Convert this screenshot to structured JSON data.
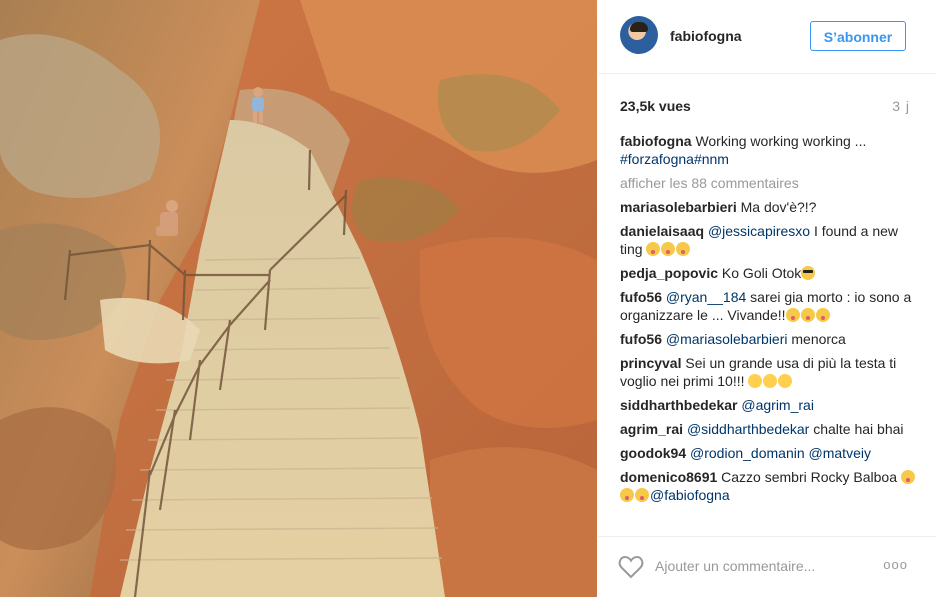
{
  "profile": {
    "username": "fabiofogna",
    "follow_label": "S’abonner"
  },
  "stats": {
    "views": "23,5k vues",
    "age": "3 j"
  },
  "caption": {
    "username": "fabiofogna",
    "text": "Working working working ...",
    "tags": "#forzafogna#nnm"
  },
  "comments_more": "afficher les 88 commentaires",
  "comments": [
    {
      "user": "mariasolebarbieri",
      "pre": "",
      "mention": "",
      "text": "Ma dov'è?!?",
      "emoji": []
    },
    {
      "user": "danielaisaaq",
      "pre": "",
      "mention": "@jessicapiresxo",
      "text": " I found a new ting ",
      "emoji": [
        "tongue",
        "tongue",
        "tongue"
      ]
    },
    {
      "user": "pedja_popovic",
      "pre": "",
      "mention": "",
      "text": "Ko Goli Otok",
      "emoji": [
        "cool"
      ]
    },
    {
      "user": "fufo56",
      "pre": "",
      "mention": "@ryan__184",
      "text": " sarei gia morto : io sono a organizzare le ... Vivande!!",
      "emoji": [
        "tongue",
        "tongue",
        "tongue"
      ]
    },
    {
      "user": "fufo56",
      "pre": "",
      "mention": "@mariasolebarbieri",
      "text": " menorca",
      "emoji": []
    },
    {
      "user": "princyval",
      "pre": "",
      "mention": "",
      "text": "Sei un grande usa di più la testa ti voglio nei primi 10!!! ",
      "emoji": [
        "kiss",
        "kiss",
        "kiss"
      ]
    },
    {
      "user": "siddharthbedekar",
      "pre": "",
      "mention": "@agrim_rai",
      "text": "",
      "emoji": []
    },
    {
      "user": "agrim_rai",
      "pre": "",
      "mention": "@siddharthbedekar",
      "text": " chalte hai bhai",
      "emoji": []
    },
    {
      "user": "goodok94",
      "pre": "",
      "mention": "@rodion_domanin @matveiy",
      "text": "",
      "emoji": []
    },
    {
      "user": "domenico8691",
      "pre": "",
      "mention": "",
      "text": "Cazzo sembri Rocky Balboa ",
      "emoji": [
        "tongue",
        "tongue",
        "tongue"
      ],
      "mention_after": "@fabiofogna"
    }
  ],
  "footer": {
    "add_comment_placeholder": "Ajouter un commentaire...",
    "more_icon": "ooo"
  },
  "icons": {
    "like": "heart-icon",
    "options": "more-options-icon"
  },
  "colors": {
    "accent": "#3897f0",
    "link": "#003569",
    "muted": "#999999"
  }
}
